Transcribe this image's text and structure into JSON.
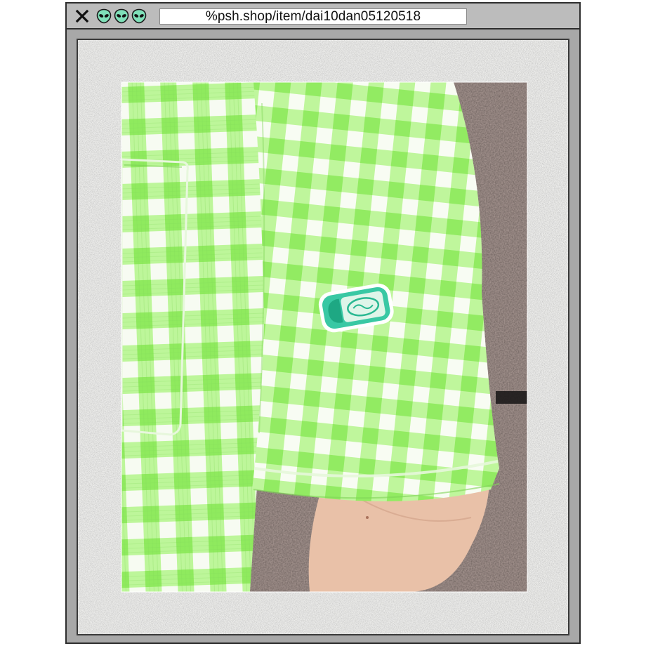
{
  "browser": {
    "url": "%psh.shop/item/dai10dan05120518",
    "tab_icons": [
      "alien-icon",
      "alien-icon",
      "alien-icon"
    ]
  },
  "colors": {
    "frame": "#a8a8a8",
    "titlebar": "#bcbcbc",
    "alien": "#7fe0b9",
    "gingham_base": "#b4f48c",
    "gingham_mid": "#8fea5e",
    "gingham_white": "#f7fbf2",
    "stone": "#5a4b47",
    "skin": "#e9c1a8"
  },
  "photo": {
    "subject": "gingham-shirt-sleeve",
    "patch_icon": "milk-bottle-patch-icon"
  }
}
